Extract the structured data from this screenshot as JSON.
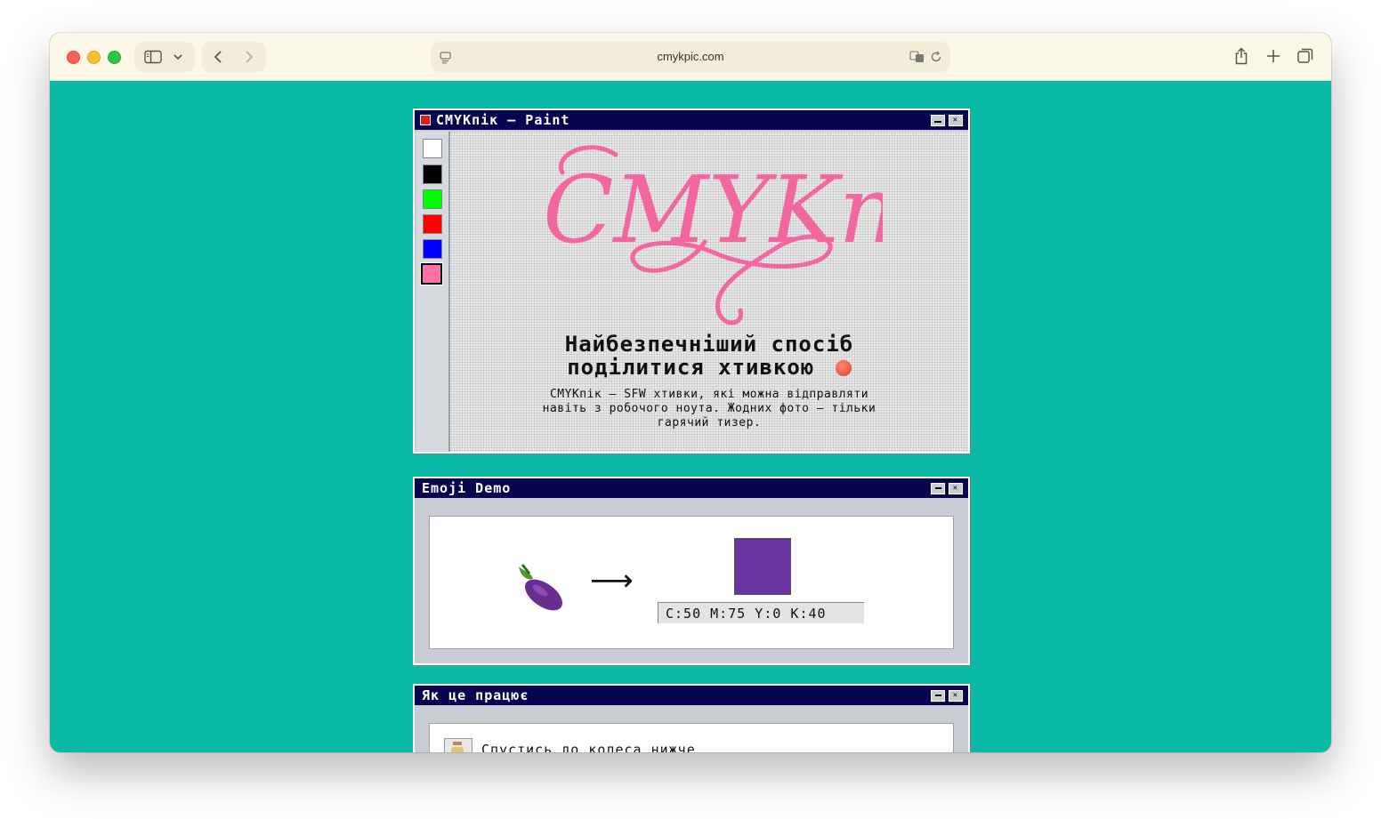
{
  "browser": {
    "url": "cmykpic.com"
  },
  "paint": {
    "title": "CMYKпік – Paint",
    "logo_text": "CMYKnik",
    "headline_line1": "Найбезпечніший спосіб",
    "headline_line2": "поділитися хтивкою",
    "desc_line1": "CMYKпік — SFW хтивки, які можна відправляти",
    "desc_line2": "навіть з робочого ноута. Жодних фото — тільки",
    "desc_line3": "гарячий тизер.",
    "palette_colors": [
      "#ffffff",
      "#000000",
      "#00ff00",
      "#ff0000",
      "#0000ff",
      "#ff6fa8"
    ],
    "accent_pink": "#f2679f"
  },
  "emoji_demo": {
    "title": "Emoji Demo",
    "emoji": "🍆",
    "arrow": "⟶",
    "result_color": "#6b33a0",
    "cmyk_label": "C:50 M:75 Y:0 K:40"
  },
  "how": {
    "title": "Як це працює",
    "step_text": "Спустись до колеса нижче"
  }
}
